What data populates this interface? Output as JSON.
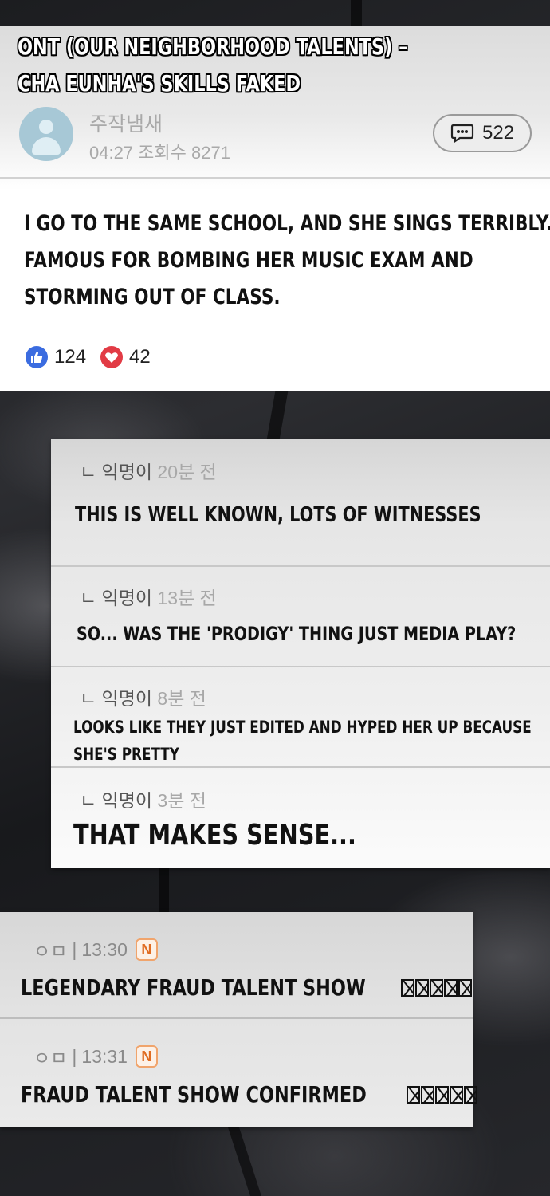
{
  "post": {
    "title_line1": "ONT (OUR NEIGHBORHOOD TALENTS) –",
    "title_line2": "CHA EUNHA'S SKILLS FAKED",
    "author": "주작냄새",
    "meta": "04:27 조회수 8271",
    "comment_count": "522",
    "body_line1": "I GO TO THE SAME SCHOOL, AND SHE SINGS TERRIBLY.",
    "body_line2": "FAMOUS FOR BOMBING HER MUSIC EXAM AND",
    "body_line3": "STORMING OUT OF CLASS.",
    "likes": "124",
    "hearts": "42"
  },
  "comments": [
    {
      "prefix": "ㄴ 익명이 ",
      "time": "20분 전",
      "text": "THIS IS WELL KNOWN, LOTS OF WITNESSES"
    },
    {
      "prefix": "ㄴ 익명이 ",
      "time": "13분 전",
      "text": "SO... WAS THE 'PRODIGY' THING JUST MEDIA PLAY?"
    },
    {
      "prefix": "ㄴ 익명이 ",
      "time": "8분 전",
      "text_line1": "LOOKS LIKE THEY JUST EDITED AND HYPED HER UP BECAUSE",
      "text_line2": "SHE'S PRETTY"
    },
    {
      "prefix": "ㄴ 익명이 ",
      "time": "3분 전",
      "text": "THAT MAKES SENSE..."
    }
  ],
  "feed": [
    {
      "author": "ㅇㅁ",
      "time": "13:30",
      "badge": "N",
      "title": "LEGENDARY FRAUD TALENT SHOW"
    },
    {
      "author": "ㅇㅁ",
      "time": "13:31",
      "badge": "N",
      "title": "FRAUD TALENT SHOW CONFIRMED"
    }
  ],
  "colors": {
    "like": "#3b6ce0",
    "heart": "#e23b45",
    "new_badge": "#e06c22"
  },
  "icons": [
    "person-icon",
    "speech-bubble-icon",
    "thumbs-up-icon",
    "heart-icon"
  ]
}
